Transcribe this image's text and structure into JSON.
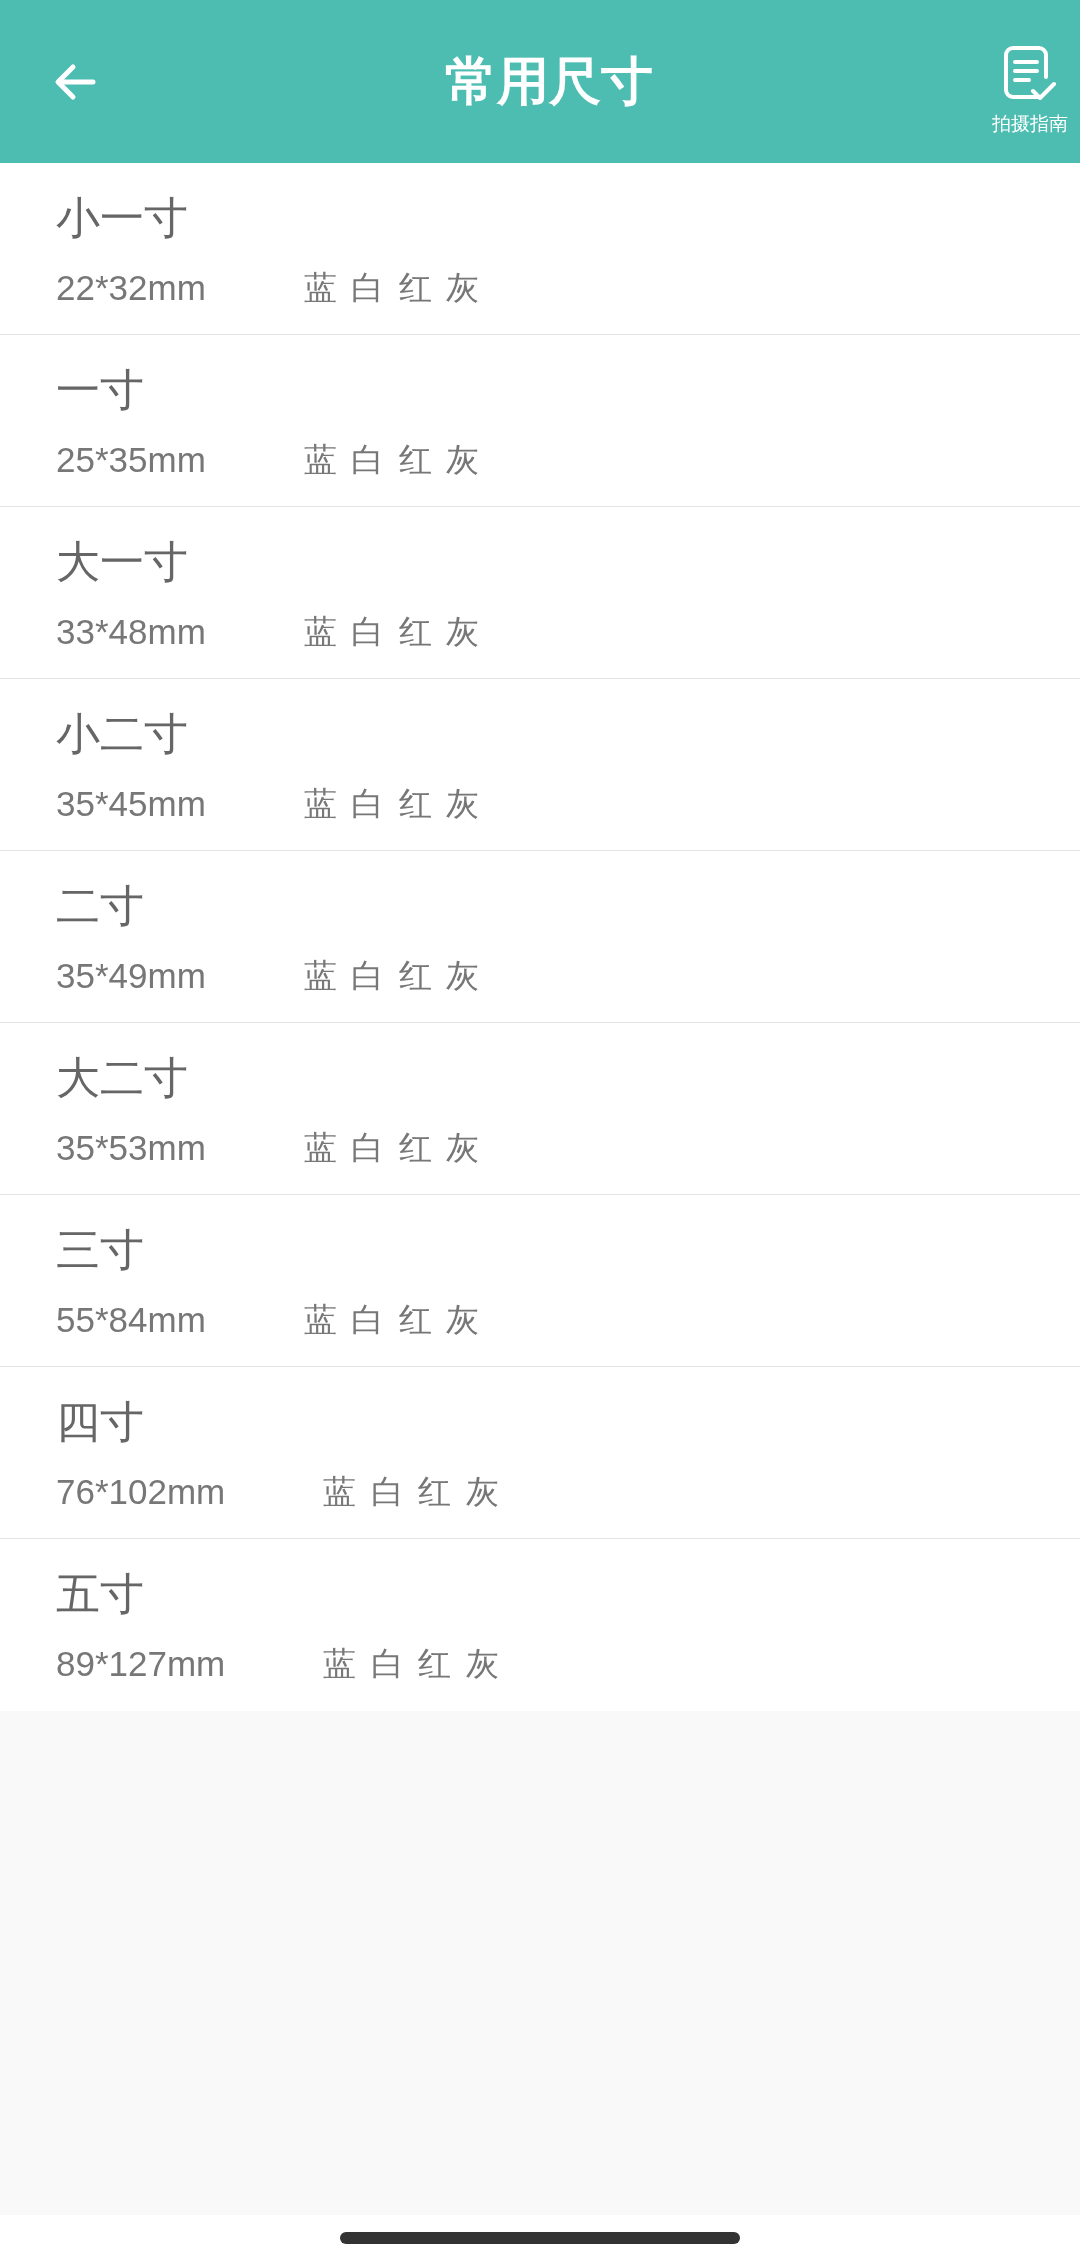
{
  "header": {
    "title": "常用尺寸",
    "guide_label": "拍摄指南"
  },
  "sizes": [
    {
      "name": "小一寸",
      "dimensions": "22*32mm",
      "colors": "蓝 白 红 灰"
    },
    {
      "name": "一寸",
      "dimensions": "25*35mm",
      "colors": "蓝 白 红 灰"
    },
    {
      "name": "大一寸",
      "dimensions": "33*48mm",
      "colors": "蓝 白 红 灰"
    },
    {
      "name": "小二寸",
      "dimensions": "35*45mm",
      "colors": "蓝 白 红 灰"
    },
    {
      "name": "二寸",
      "dimensions": "35*49mm",
      "colors": "蓝 白 红 灰"
    },
    {
      "name": "大二寸",
      "dimensions": "35*53mm",
      "colors": "蓝 白 红 灰"
    },
    {
      "name": "三寸",
      "dimensions": "55*84mm",
      "colors": "蓝 白 红 灰"
    },
    {
      "name": "四寸",
      "dimensions": "76*102mm",
      "colors": "蓝 白 红 灰"
    },
    {
      "name": "五寸",
      "dimensions": "89*127mm",
      "colors": "蓝 白 红 灰"
    }
  ]
}
